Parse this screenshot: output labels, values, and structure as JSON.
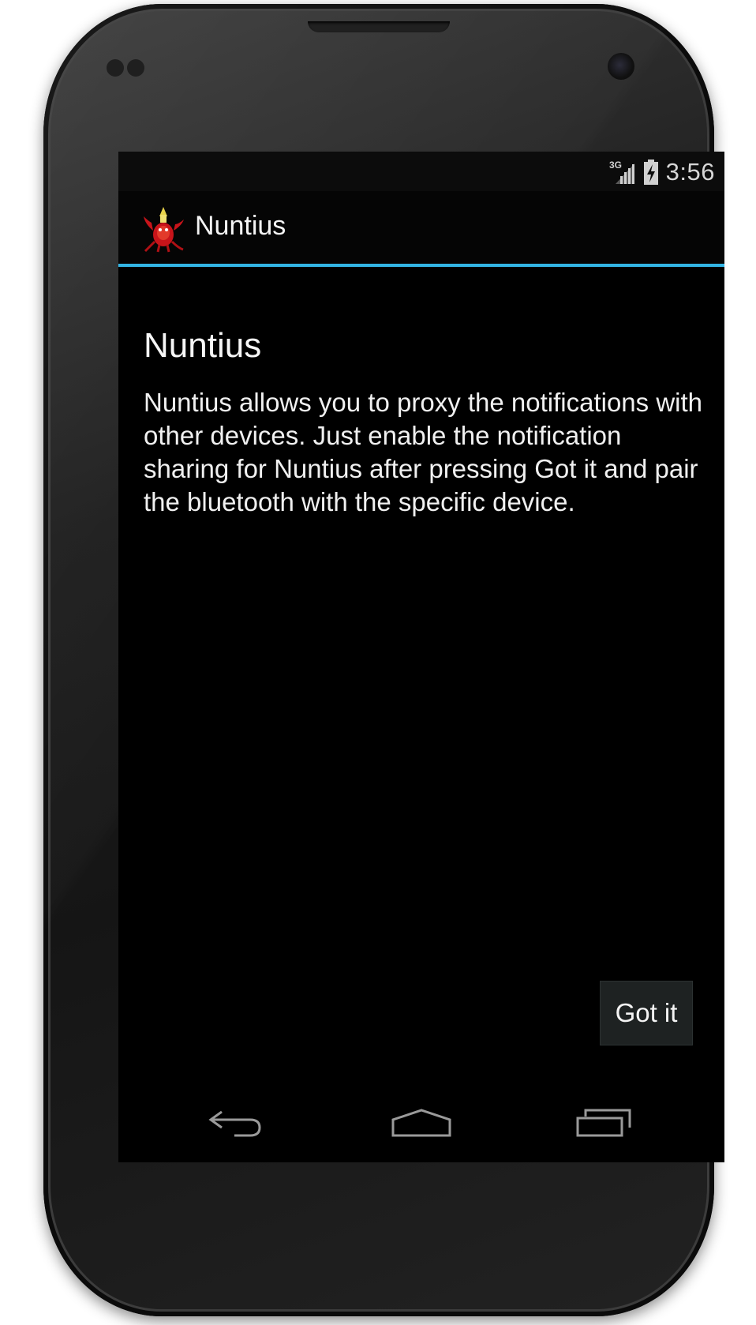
{
  "status_bar": {
    "network_label": "3G",
    "time": "3:56"
  },
  "action_bar": {
    "title": "Nuntius",
    "accent_color": "#33b5e5"
  },
  "content": {
    "title": "Nuntius",
    "body": "Nuntius allows you to proxy the notifications with other devices. Just enable the notification sharing for Nuntius after pressing Got it and pair the bluetooth with the specific device."
  },
  "button": {
    "label": "Got it"
  },
  "navigation": {
    "icons": [
      "back-icon",
      "home-icon",
      "recent-apps-icon"
    ]
  }
}
